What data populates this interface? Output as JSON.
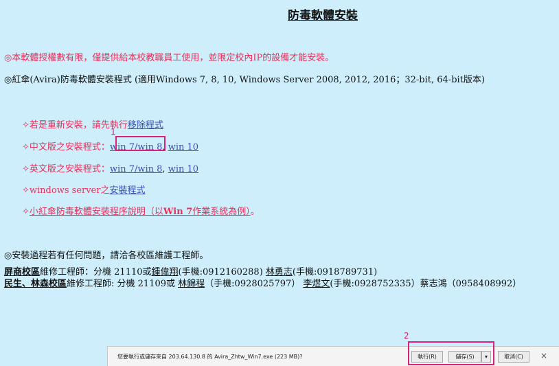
{
  "title": "防毒軟體安裝",
  "notice1": "◎本軟體授權數有限，僅提供給本校教職員工使用，並限定校內IP的設備才能安裝。",
  "notice2": "◎紅傘(Avira)防毒軟體安裝程式 (適用Windows 7, 8, 10, Windows Server 2008, 2012, 2016；32-bit, 64-bit版本)",
  "items": {
    "reinstall_prefix": "✧若是重新安裝，請先執行",
    "reinstall_link": "移除程式",
    "zh_prefix": "✧中文版之安裝程式：",
    "zh_link1": "win 7/win 8",
    "zh_sep": ", ",
    "zh_link2": "win 10",
    "en_prefix": "✧英文版之安裝程式：",
    "en_link1": "win 7/win 8",
    "en_sep": ", ",
    "en_link2": "win 10",
    "ws_prefix": "✧windows server之",
    "ws_link": "安裝程式",
    "guide_prefix": "✧",
    "guide_link_a": "小紅傘防毒軟體安裝程序說明（以",
    "guide_link_b": "Win 7",
    "guide_link_c": "作業系統為例）",
    "guide_suffix": "。"
  },
  "help": "◎安裝過程若有任何問題，請洽各校區維護工程師。",
  "contacts": {
    "row1_campus": "屏商校區",
    "row1_a": "維修工程師：分機 21110或",
    "row1_name1": "鍾偉翔",
    "row1_b": "(手機:0912160288)  ",
    "row1_name2": "林勇志",
    "row1_c": "(手機:0918789731)",
    "row2_campus": "民生、林森校區",
    "row2_a": "維修工程師: 分機 21109或 ",
    "row2_name1": "林錦程",
    "row2_b": "（手機:0928025797）  ",
    "row2_name2": "李煜文",
    "row2_c": "(手機:0928752335）蔡志鴻（0958408992）"
  },
  "annotations": {
    "one": "1",
    "two": "2"
  },
  "download": {
    "message": "您要執行或儲存來自 203.64.130.8 的 Avira_Zhtw_Win7.exe (223 MB)?",
    "run": "執行(R)",
    "save": "儲存(S)",
    "dropdown": "▾",
    "cancel": "取消(C)",
    "close": "×"
  }
}
